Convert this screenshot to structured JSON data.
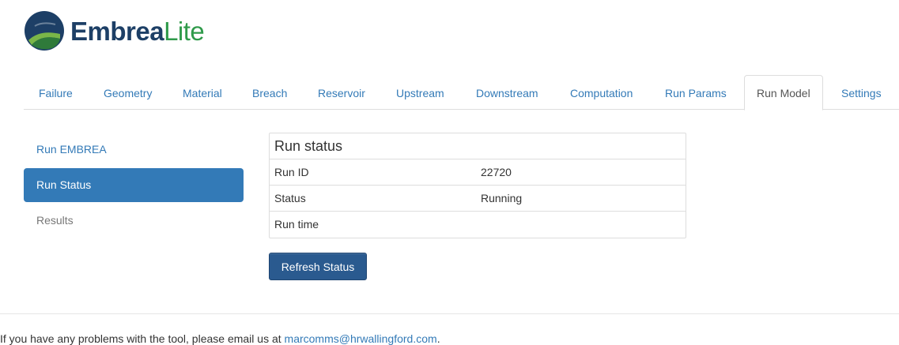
{
  "brand": {
    "logo_icon": "embrea-logo-icon",
    "name_part1": "Embrea",
    "name_part2": "Lite",
    "colors": {
      "navy": "#1d3f66",
      "green": "#2f9a4a"
    }
  },
  "tabs": [
    {
      "label": "Failure",
      "active": false
    },
    {
      "label": "Geometry",
      "active": false
    },
    {
      "label": "Material",
      "active": false
    },
    {
      "label": "Breach",
      "active": false
    },
    {
      "label": "Reservoir",
      "active": false
    },
    {
      "label": "Upstream",
      "active": false
    },
    {
      "label": "Downstream",
      "active": false
    },
    {
      "label": "Computation",
      "active": false
    },
    {
      "label": "Run Params",
      "active": false
    },
    {
      "label": "Run Model",
      "active": true
    },
    {
      "label": "Settings",
      "active": false
    }
  ],
  "sidebar": {
    "items": [
      {
        "label": "Run EMBREA",
        "active": false
      },
      {
        "label": "Run Status",
        "active": true
      },
      {
        "label": "Results",
        "active": false
      }
    ]
  },
  "run_status": {
    "title": "Run status",
    "rows": [
      {
        "label": "Run ID",
        "value": "22720"
      },
      {
        "label": "Status",
        "value": "Running"
      },
      {
        "label": "Run time",
        "value": ""
      }
    ],
    "refresh_label": "Refresh Status"
  },
  "footer": {
    "text": "If you have any problems with the tool, please email us at ",
    "email": "marcomms@hrwallingford.com",
    "suffix": "."
  },
  "colors": {
    "accent": "#337ab7",
    "button": "#2a5a8f",
    "border": "#dddddd"
  }
}
